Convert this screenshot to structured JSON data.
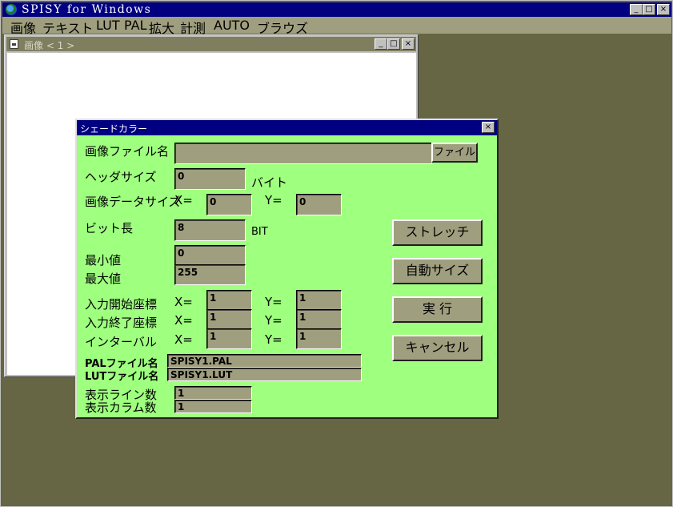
{
  "window": {
    "title": "SPISY for Windows",
    "min_glyph": "_",
    "max_glyph": "□",
    "close_glyph": "×"
  },
  "menu": [
    "画像",
    "テキスト",
    "LUT",
    "PAL",
    "拡大",
    "計測",
    "AUTO",
    "ブラウズ"
  ],
  "child_window": {
    "title": "画像 < 1 >"
  },
  "dialog": {
    "title": "シェードカラー",
    "file_label": "画像ファイル名",
    "file_value": "",
    "file_button": "ファイル",
    "header_size_label": "ヘッダサイズ",
    "header_size_value": "0",
    "header_size_unit": "バイト",
    "data_size_label": "画像データサイズ",
    "data_size_x_label": "X=",
    "data_size_x": "0",
    "data_size_y_label": "Y=",
    "data_size_y": "0",
    "bit_length_label": "ビット長",
    "bit_length_value": "8",
    "bit_length_unit": "BIT",
    "min_label": "最小値",
    "min_value": "0",
    "max_label": "最大値",
    "max_value": "255",
    "input_start_label": "入力開始座標",
    "input_start_x_label": "X=",
    "input_start_x": "1",
    "input_start_y_label": "Y=",
    "input_start_y": "1",
    "input_end_label": "入力終了座標",
    "input_end_x_label": "X=",
    "input_end_x": "1",
    "input_end_y_label": "Y=",
    "input_end_y": "1",
    "interval_label": "インターバル",
    "interval_x_label": "X=",
    "interval_x": "1",
    "interval_y_label": "Y=",
    "interval_y": "1",
    "pal_label": "PALファイル名",
    "pal_value": "SPISY1.PAL",
    "lut_label": "LUTファイル名",
    "lut_value": "SPISY1.LUT",
    "lines_label": "表示ライン数",
    "lines_value": "1",
    "columns_label": "表示カラム数",
    "columns_value": "1",
    "btn_stretch": "ストレッチ",
    "btn_autosize": "自動サイズ",
    "btn_execute": "実 行",
    "btn_cancel": "キャンセル",
    "close_glyph": "×"
  },
  "colors": {
    "dialog_bg": "#9fff7f",
    "field_bg": "#9f9f7f",
    "title_active": "#000080",
    "desktop": "#666644"
  }
}
